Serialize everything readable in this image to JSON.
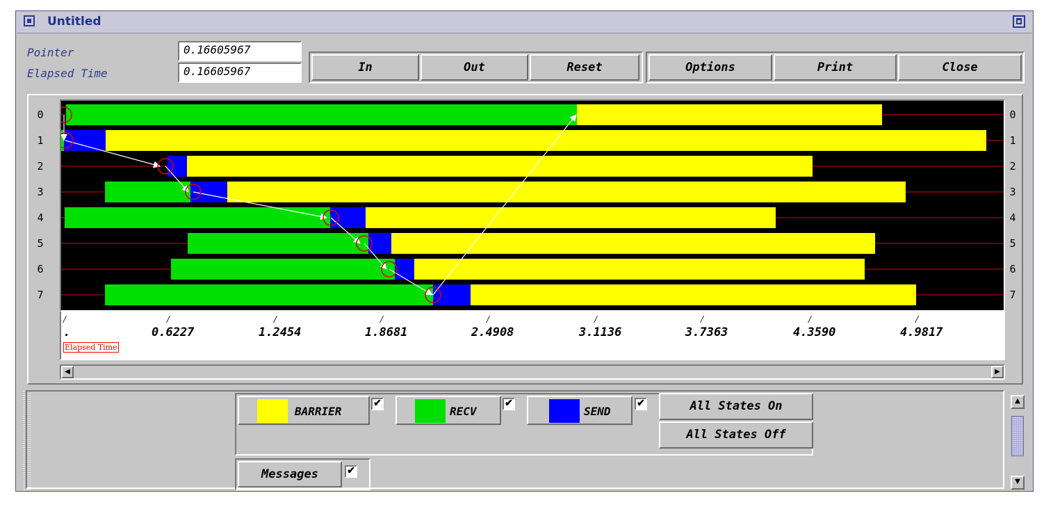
{
  "window": {
    "title": "Untitled"
  },
  "info": {
    "pointer_label": "Pointer",
    "pointer_value": "0.16605967",
    "elapsed_label": "Elapsed Time",
    "elapsed_value": "0.16605967"
  },
  "toolbar": {
    "in_label": "In",
    "out_label": "Out",
    "reset_label": "Reset",
    "options_label": "Options",
    "print_label": "Print",
    "close_label": "Close"
  },
  "timeline": {
    "rows": [
      "0",
      "1",
      "2",
      "3",
      "4",
      "5",
      "6",
      "7"
    ],
    "axis_ticks": [
      ".",
      "0.6227",
      "1.2454",
      "1.8681",
      "2.4908",
      "3.1136",
      "3.7363",
      "4.3590",
      "4.9817"
    ],
    "axis_label": "Elapsed Time",
    "colors": {
      "BARRIER": "#ffff00",
      "RECV": "#00e000",
      "SEND": "#0000ff",
      "grid_line": "#d40000",
      "background": "#000000",
      "message": "#ffffff"
    }
  },
  "legend": {
    "states": [
      {
        "name": "BARRIER",
        "color": "#ffff00",
        "checked": true
      },
      {
        "name": "RECV",
        "color": "#00e000",
        "checked": true
      },
      {
        "name": "SEND",
        "color": "#0000ff",
        "checked": true
      }
    ],
    "all_on_label": "All States On",
    "all_off_label": "All States Off",
    "messages_label": "Messages",
    "messages_checked": true
  }
}
